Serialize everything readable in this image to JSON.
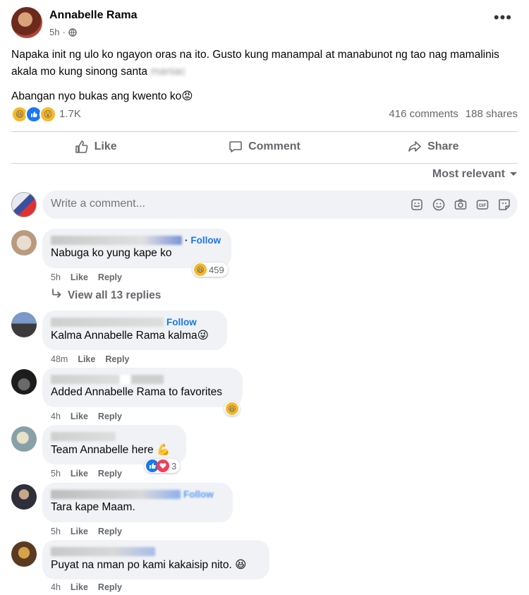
{
  "post": {
    "author": "Annabelle Rama",
    "time": "5h",
    "separator": "·",
    "text_line1": "Napaka init ng ulo ko ngayon oras na ito. Gusto kung manampal at manabunot ng tao nag mamalinis akala mo kung sinong santa",
    "text_blurred": "maniac",
    "text_line2": "Abangan nyo bukas ang kwento ko",
    "text_line2_emoji": "😡",
    "reaction_count": "1.7K",
    "comments_count": "416 comments",
    "shares_count": "188 shares"
  },
  "actions": {
    "like": "Like",
    "comment": "Comment",
    "share": "Share"
  },
  "sort": {
    "label": "Most relevant"
  },
  "composer": {
    "placeholder": "Write a comment..."
  },
  "comments": [
    {
      "text": "Nabuga ko yung kape ko",
      "follow": "Follow",
      "time": "5h",
      "like": "Like",
      "reply": "Reply",
      "reaction_count": "459"
    },
    {
      "text": "Kalma Annabelle Rama kalma",
      "emoji": "😜",
      "follow": "Follow",
      "time": "48m",
      "like": "Like",
      "reply": "Reply"
    },
    {
      "text": "Added Annabelle Rama to favorites",
      "time": "4h",
      "like": "Like",
      "reply": "Reply"
    },
    {
      "text": "Team Annabelle here",
      "emoji": "💪",
      "time": "5h",
      "like": "Like",
      "reply": "Reply",
      "reaction_count": "3"
    },
    {
      "text": "Tara kape Maam.",
      "follow": "Follow",
      "time": "5h",
      "like": "Like",
      "reply": "Reply"
    },
    {
      "text": "Puyat na nman po kami kakaisip nito.",
      "emoji": "😆",
      "time": "4h",
      "like": "Like",
      "reply": "Reply"
    }
  ],
  "view_replies": "View all 13 replies",
  "icons": [
    "globe-icon",
    "more-icon",
    "like-icon",
    "comment-icon",
    "share-icon",
    "caret-down-icon",
    "sticker-icon",
    "emoji-icon",
    "camera-icon",
    "gif-icon",
    "avatar-sticker-icon",
    "reply-arrow-icon"
  ],
  "colors": {
    "accent": "#1877f2",
    "muted": "#65676b",
    "bubble": "#f0f2f5",
    "heart": "#f33e58"
  }
}
